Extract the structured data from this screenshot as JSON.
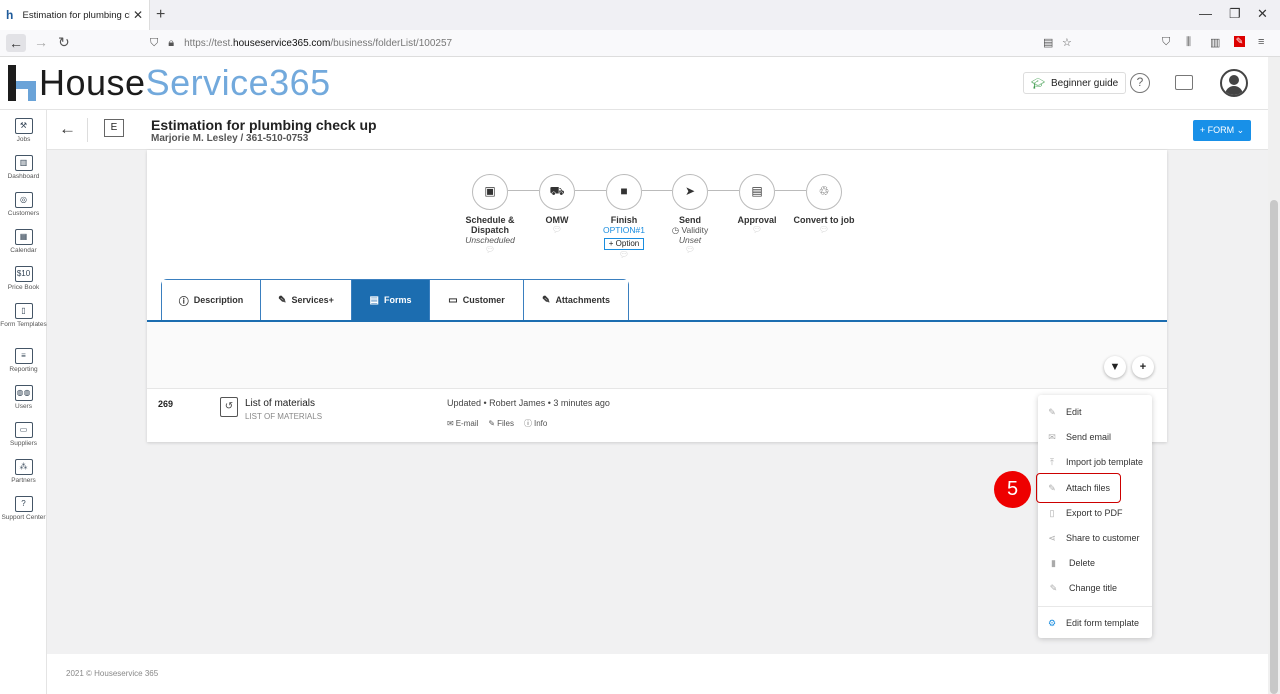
{
  "browser": {
    "tab_title": "Estimation for plumbing check up",
    "tab_close": "✕",
    "new_tab": "+",
    "url_prefix": "https://test.",
    "url_host": "houseservice365.com",
    "url_path": "/business/folderList/100257",
    "win_min": "—",
    "win_max": "❐",
    "win_close": "✕"
  },
  "app": {
    "logo_part1": "House",
    "logo_part2": "Service365",
    "beginner_guide": "Beginner guide",
    "help_icon": "?"
  },
  "sidebar": [
    {
      "label": "Jobs",
      "icon": "tools-icon",
      "glyph": "⚒"
    },
    {
      "label": "Dashboard",
      "icon": "chart-icon",
      "glyph": "▥"
    },
    {
      "label": "Customers",
      "icon": "target-icon",
      "glyph": "◎"
    },
    {
      "label": "Calendar",
      "icon": "calendar-icon",
      "glyph": "▦"
    },
    {
      "label": "Price Book",
      "icon": "price-icon",
      "glyph": "$10"
    },
    {
      "label": "Form Templates",
      "icon": "form-icon",
      "glyph": "▯"
    },
    {
      "label": "Reporting",
      "icon": "report-icon",
      "glyph": "≡"
    },
    {
      "label": "Users",
      "icon": "users-icon",
      "glyph": "◍◍"
    },
    {
      "label": "Suppliers",
      "icon": "truck-icon",
      "glyph": "▭"
    },
    {
      "label": "Partners",
      "icon": "partners-icon",
      "glyph": "⁂"
    },
    {
      "label": "Support Center",
      "icon": "support-icon",
      "glyph": "?"
    }
  ],
  "page": {
    "back": "←",
    "badge": "E",
    "title": "Estimation for plumbing check up",
    "subtitle": "Marjorie M. Lesley / 361-510-0753",
    "form_button": "+ FORM ⌄"
  },
  "steps": [
    {
      "label": "Schedule & Dispatch",
      "sub": "Unscheduled",
      "glyph": "▣",
      "icon": "calendar-check-icon"
    },
    {
      "label": "OMW",
      "sub": "",
      "glyph": "⛟",
      "icon": "truck-icon"
    },
    {
      "label": "Finish",
      "sub": "OPTION#1",
      "option": "+ Option",
      "glyph": "■",
      "icon": "stop-icon"
    },
    {
      "label": "Send",
      "sub": "Validity",
      "sub2": "Unset",
      "glyph": "➤",
      "icon": "send-icon"
    },
    {
      "label": "Approval",
      "sub": "",
      "glyph": "▤",
      "icon": "approval-icon"
    },
    {
      "label": "Convert to job",
      "sub": "",
      "glyph": "♲",
      "icon": "convert-icon"
    }
  ],
  "tabs": [
    {
      "label": "Description",
      "glyph": "ⓘ"
    },
    {
      "label": "Services+",
      "glyph": "✎"
    },
    {
      "label": "Forms",
      "glyph": "▤",
      "active": true
    },
    {
      "label": "Customer",
      "glyph": "▭"
    },
    {
      "label": "Attachments",
      "glyph": "✎"
    }
  ],
  "toolbar": {
    "filter": "▼",
    "add": "+"
  },
  "form_row": {
    "number": "269",
    "name": "List of materials",
    "type": "LIST OF MATERIALS",
    "updated": "Updated • Robert James • 3 minutes ago",
    "email": "E-mail",
    "files": "Files",
    "info": "Info"
  },
  "menu": [
    {
      "label": "Edit",
      "glyph": "✎"
    },
    {
      "label": "Send email",
      "glyph": "✉"
    },
    {
      "label": "Import job template",
      "glyph": "⤒"
    },
    {
      "label": "Attach files",
      "glyph": "✎"
    },
    {
      "label": "Export to PDF",
      "glyph": "▯"
    },
    {
      "label": "Share to customer",
      "glyph": "⋖"
    },
    {
      "label": "Delete",
      "glyph": "▮"
    },
    {
      "label": "Change title",
      "glyph": "✎"
    },
    {
      "label": "Edit form template",
      "glyph": "⚙"
    }
  ],
  "annotation": {
    "step": "5"
  },
  "footer": {
    "copyright": "2021 © Houseservice 365"
  },
  "colors": {
    "accent": "#1c6db0",
    "button": "#1890e8",
    "logo_blue": "#72a9dc",
    "annotation": "#e00000"
  }
}
